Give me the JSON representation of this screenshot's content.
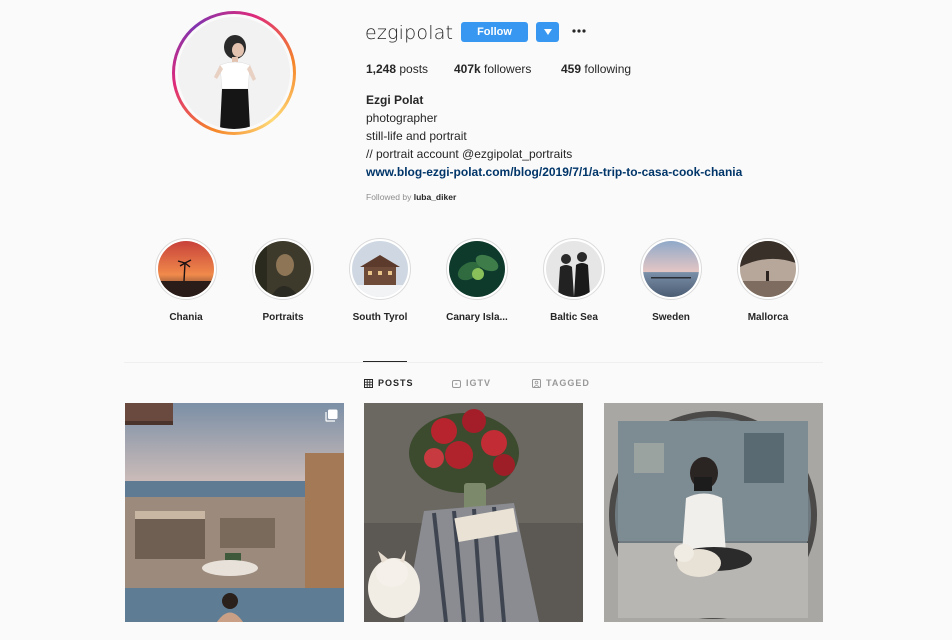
{
  "profile": {
    "username": "ezgipolat",
    "follow_label": "Follow",
    "dropdown_icon": "chevron-down-icon",
    "more_icon": "more-options-icon",
    "stats": {
      "posts_count": "1,248",
      "posts_label": "posts",
      "followers_count": "407k",
      "followers_label": "followers",
      "following_count": "459",
      "following_label": "following"
    },
    "full_name": "Ezgi Polat",
    "bio_lines": [
      "photographer",
      "still-life and portrait",
      "// portrait account @ezgipolat_portraits"
    ],
    "link": "www.blog-ezgi-polat.com/blog/2019/7/1/a-trip-to-casa-cook-chania",
    "followed_by_prefix": "Followed by",
    "followed_by_user": "luba_diker"
  },
  "highlights": [
    {
      "label": "Chania"
    },
    {
      "label": "Portraits"
    },
    {
      "label": "South Tyrol"
    },
    {
      "label": "Canary Isla..."
    },
    {
      "label": "Baltic Sea"
    },
    {
      "label": "Sweden"
    },
    {
      "label": "Mallorca"
    }
  ],
  "tabs": [
    {
      "label": "POSTS",
      "icon": "grid-icon",
      "active": true
    },
    {
      "label": "IGTV",
      "icon": "igtv-icon",
      "active": false
    },
    {
      "label": "TAGGED",
      "icon": "tagged-icon",
      "active": false
    }
  ],
  "posts": [
    {
      "multi": true,
      "multi_icon": "multiple-images-icon"
    },
    {
      "multi": false
    },
    {
      "multi": false
    }
  ],
  "colors": {
    "follow_blue": "#3897f0",
    "link_blue": "#003569",
    "background": "#fafafa"
  }
}
